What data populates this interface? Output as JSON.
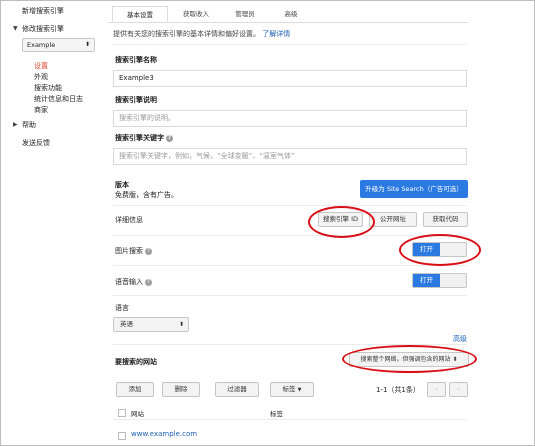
{
  "sidebar": {
    "new_engine": "新增搜索引擎",
    "edit_engine": "修改搜索引擎",
    "engine_select": "Example",
    "items": [
      "设置",
      "外观",
      "搜索功能",
      "统计信息和日志",
      "商家"
    ],
    "help": "帮助",
    "feedback": "发送反馈"
  },
  "tabs": [
    "基本设置",
    "获取收入",
    "管理员",
    "高级"
  ],
  "main": {
    "intro": "提供有关您的搜索引擎的基本详情和偏好设置。",
    "learn_more": "了解详情",
    "name_label": "搜索引擎名称",
    "name_value": "Example3",
    "desc_label": "搜索引擎说明",
    "desc_placeholder": "搜索引擎的说明。",
    "keywords_label": "搜索引擎关键字",
    "keywords_placeholder": "搜索引擎关键字，例如，气候，“全球变暖”，“温室气体”",
    "edition_label": "版本",
    "edition_value": "免费版，含有广告。",
    "upgrade_button": "升级为 Site Search（广告可选）",
    "details_label": "详细信息",
    "engine_id_button": "搜索引擎 ID",
    "public_url_button": "公开网址",
    "get_code_button": "获取代码",
    "image_search_label": "图片搜索",
    "image_search_toggle": "打开",
    "voice_label": "语音输入",
    "voice_toggle": "打开",
    "language_label": "语言",
    "language_value": "英语",
    "advanced_link": "高级",
    "sites_label": "要搜索的网站",
    "sites_select": "搜索整个网络，但强调包含的网站",
    "add_button": "添加",
    "delete_button": "删除",
    "filter_button": "过滤器",
    "labels_button": "标签",
    "pagination": "1-1（共1条）",
    "col_site": "网站",
    "col_label": "标签",
    "site_row": "www.example.com"
  },
  "colors": {
    "accent": "#2a7ae2",
    "highlight": "#d90f16",
    "active_nav": "#dd4b39"
  }
}
